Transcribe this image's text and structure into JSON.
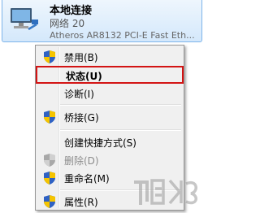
{
  "connection": {
    "title": "本地连接",
    "network": "网络  20",
    "adapter": "Atheros AR8132 PCI-E Fast Eth..."
  },
  "menu": {
    "items": [
      {
        "label": "禁用(B)",
        "icon": "uac-shield-icon",
        "disabled": false,
        "highlighted": false
      },
      {
        "label": "状态(U)",
        "icon": "",
        "disabled": false,
        "highlighted": true
      },
      {
        "label": "诊断(I)",
        "icon": "",
        "disabled": false,
        "highlighted": false
      },
      {
        "label": "桥接(G)",
        "icon": "uac-shield-icon",
        "disabled": false,
        "highlighted": false
      },
      {
        "label": "创建快捷方式(S)",
        "icon": "",
        "disabled": false,
        "highlighted": false
      },
      {
        "label": "删除(D)",
        "icon": "uac-shield-icon",
        "disabled": true,
        "highlighted": false
      },
      {
        "label": "重命名(M)",
        "icon": "uac-shield-icon",
        "disabled": false,
        "highlighted": false
      },
      {
        "label": "属性(R)",
        "icon": "uac-shield-icon",
        "disabled": false,
        "highlighted": false
      }
    ]
  },
  "colors": {
    "highlight_border": "#d31414",
    "menu_background": "#f0f0f0",
    "tile_border": "#7eb4ea"
  }
}
